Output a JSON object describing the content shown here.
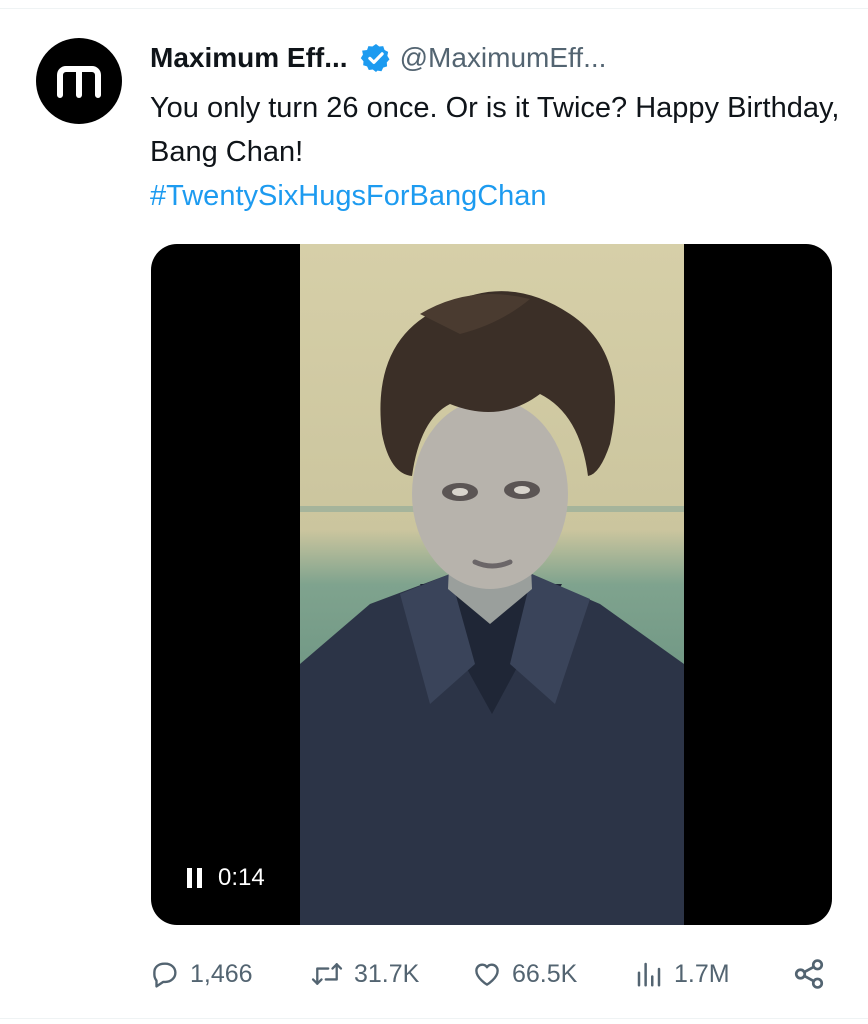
{
  "tweet": {
    "avatar_letter": "m",
    "display_name": "Maximum Eff...",
    "handle": "@MaximumEff...",
    "text": "You only turn 26 once. Or is it Twice? Happy Birthday, Bang Chan!",
    "hashtag": "#TwentySixHugsForBangChan",
    "verified": true
  },
  "video": {
    "state": "playing",
    "time": "0:14"
  },
  "actions": {
    "replies": "1,466",
    "reposts": "31.7K",
    "likes": "66.5K",
    "views": "1.7M"
  },
  "colors": {
    "link": "#1d9bf0",
    "muted": "#536471",
    "verified_badge": "#1d9bf0"
  },
  "icons": [
    "reply-icon",
    "repost-icon",
    "like-icon",
    "views-icon",
    "share-icon",
    "pause-icon",
    "verified-badge-icon"
  ]
}
